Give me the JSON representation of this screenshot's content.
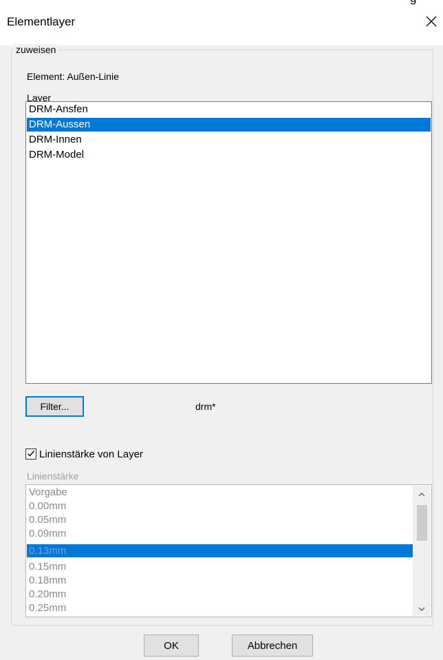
{
  "window": {
    "title": "Elementlayer",
    "clipped_text": "g"
  },
  "group": {
    "legend": "zuweisen",
    "element_label": "Element: Außen-Linie"
  },
  "layers": {
    "label": "Layer",
    "items": [
      {
        "label": "DRM-Ansfen",
        "selected": false
      },
      {
        "label": "DRM-Aussen",
        "selected": true
      },
      {
        "label": "DRM-Innen",
        "selected": false
      },
      {
        "label": "DRM-Model",
        "selected": false
      }
    ]
  },
  "filter": {
    "button_label": "Filter...",
    "value": "drm*"
  },
  "linewidth_checkbox": {
    "label": "Linienstärke von Layer",
    "checked": true
  },
  "linewidth": {
    "label": "Linienstärke",
    "items": [
      {
        "label": "Vorgabe",
        "selected": false
      },
      {
        "label": "0.00mm",
        "selected": false
      },
      {
        "label": "0.05mm",
        "selected": false
      },
      {
        "label": "0.09mm",
        "selected": false
      },
      {
        "label": "0.13mm",
        "selected": true
      },
      {
        "label": "0.15mm",
        "selected": false
      },
      {
        "label": "0.18mm",
        "selected": false
      },
      {
        "label": "0.20mm",
        "selected": false
      },
      {
        "label": "0.25mm",
        "selected": false
      }
    ]
  },
  "buttons": {
    "ok": "OK",
    "cancel": "Abbrechen"
  },
  "colors": {
    "selection": "#0078d7",
    "dialog_bg": "#f0f0f0"
  }
}
